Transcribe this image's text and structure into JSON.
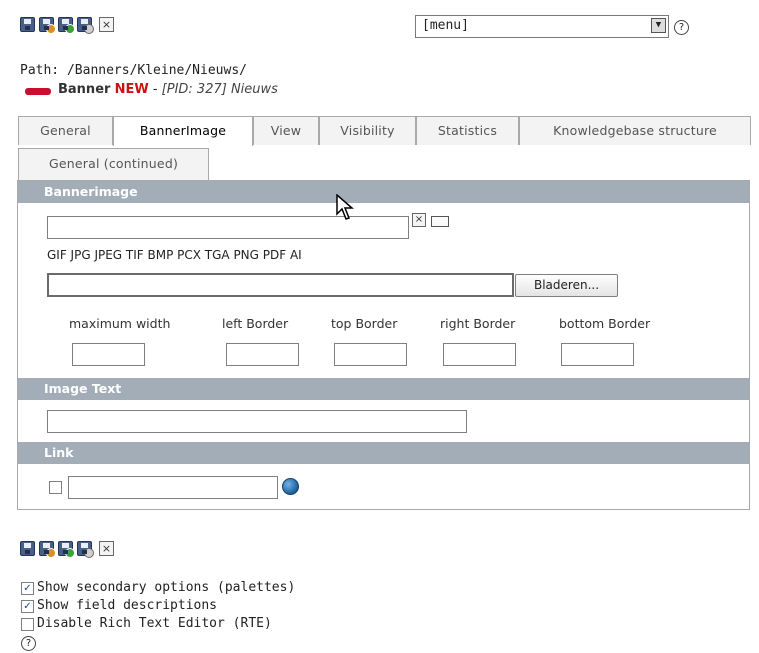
{
  "toolbar": {
    "icons": [
      "save-icon",
      "save-and-view-icon",
      "save-and-new-icon",
      "save-and-close-icon",
      "close-icon"
    ],
    "close_glyph": "×"
  },
  "menu": {
    "selected": "[menu]",
    "help_glyph": "?"
  },
  "path": {
    "text": "Path: /Banners/Kleine/Nieuws/"
  },
  "record": {
    "title": "Banner",
    "status": "NEW",
    "separator": "-",
    "pid": "[PID: 327]",
    "name": "Nieuws"
  },
  "tabs": [
    {
      "label": "General"
    },
    {
      "label": "BannerImage"
    },
    {
      "label": "View"
    },
    {
      "label": "Visibility"
    },
    {
      "label": "Statistics"
    },
    {
      "label": "Knowledgebase structure"
    },
    {
      "label": "General (continued)"
    }
  ],
  "sections": {
    "bannerimage": {
      "title": "Bannerimage",
      "file_types": "GIF JPG JPEG TIF BMP PCX TGA PNG PDF AI",
      "browse_label": "Bladeren...",
      "close_glyph": "×",
      "dimensions": [
        {
          "label": "maximum width",
          "value": ""
        },
        {
          "label": "left Border",
          "value": ""
        },
        {
          "label": "top Border",
          "value": ""
        },
        {
          "label": "right Border",
          "value": ""
        },
        {
          "label": "bottom Border",
          "value": ""
        }
      ]
    },
    "image_text": {
      "title": "Image Text",
      "value": ""
    },
    "link": {
      "title": "Link",
      "value": ""
    }
  },
  "bottom_toolbar": {
    "icons": [
      "save-icon",
      "save-and-view-icon",
      "save-and-new-icon",
      "save-and-close-icon",
      "close-icon"
    ],
    "close_glyph": "×"
  },
  "options": [
    {
      "label": "Show secondary options (palettes)",
      "checked": true,
      "mark": "✓"
    },
    {
      "label": "Show field descriptions",
      "checked": true,
      "mark": "✓"
    },
    {
      "label": "Disable Rich Text Editor (RTE)",
      "checked": false,
      "mark": ""
    }
  ],
  "footer": {
    "help_glyph": "?"
  },
  "colors": {
    "section_bar": "#a3adb8",
    "new_red": "#cc1111",
    "tab_border": "#a9a9a9"
  }
}
